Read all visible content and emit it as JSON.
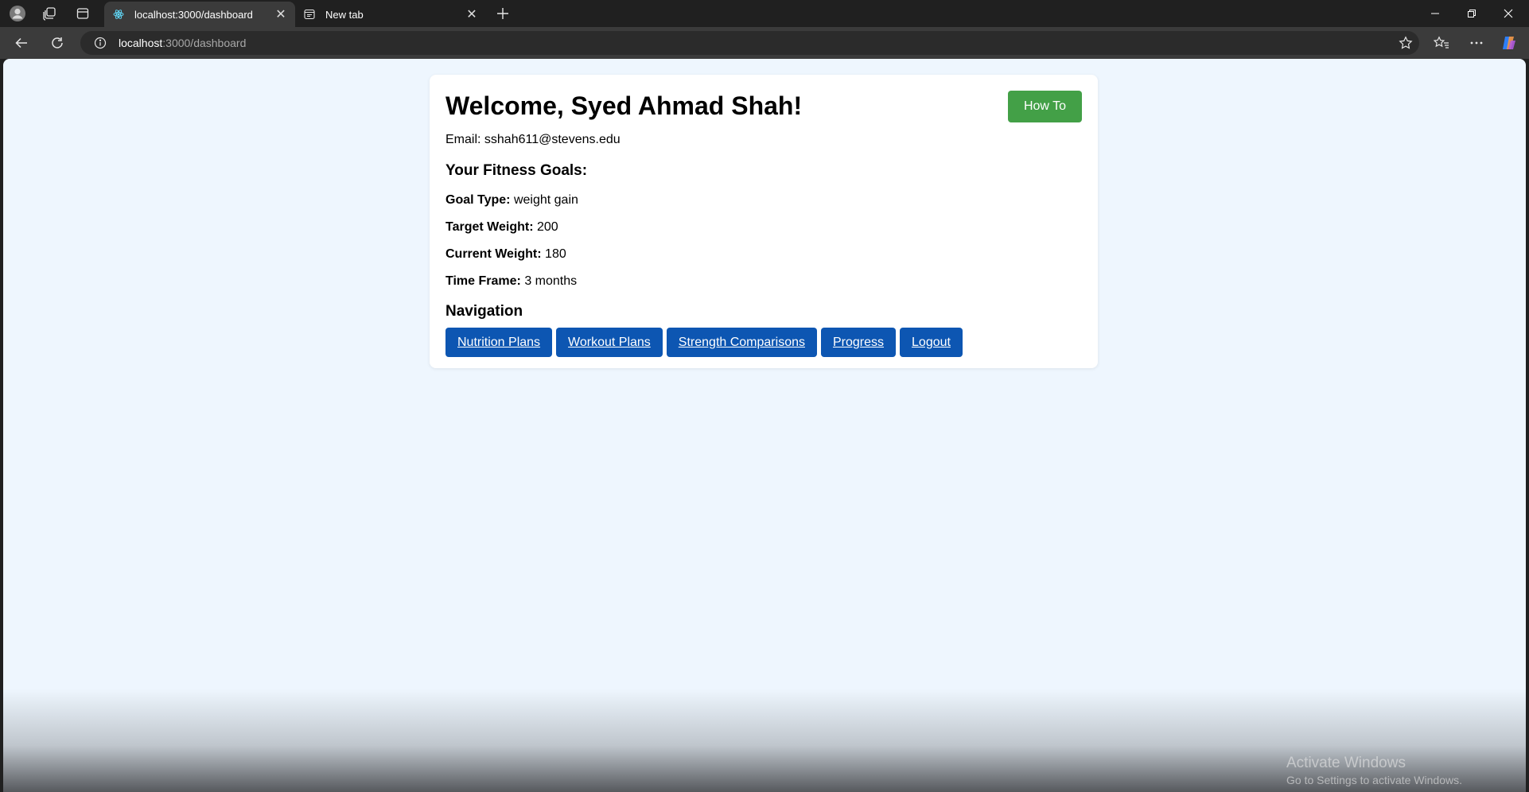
{
  "tabs": [
    {
      "title": "localhost:3000/dashboard",
      "active": true,
      "favicon": "react-icon"
    },
    {
      "title": "New tab",
      "active": false,
      "favicon": "newtab-icon"
    }
  ],
  "address": {
    "host": "localhost",
    "path": ":3000/dashboard"
  },
  "page": {
    "heading": "Welcome, Syed Ahmad Shah!",
    "how_to": "How To",
    "email_label": "Email:",
    "email": "sshah611@stevens.edu",
    "goals_heading": "Your Fitness Goals:",
    "goals": [
      {
        "label": "Goal Type:",
        "value": "weight gain"
      },
      {
        "label": "Target Weight:",
        "value": "200"
      },
      {
        "label": "Current Weight:",
        "value": "180"
      },
      {
        "label": "Time Frame:",
        "value": "3 months"
      }
    ],
    "nav_heading": "Navigation",
    "nav": [
      "Nutrition Plans",
      "Workout Plans",
      "Strength Comparisons",
      "Progress",
      "Logout"
    ]
  },
  "watermark": {
    "line1": "Activate Windows",
    "line2": "Go to Settings to activate Windows."
  },
  "colors": {
    "how_to": "#43a047",
    "nav_button": "#0d56b2",
    "page_bg": "#eef6fe"
  }
}
